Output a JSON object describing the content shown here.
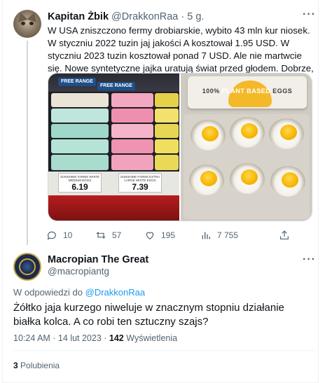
{
  "tweet": {
    "author_name": "Kapitan Żbik",
    "author_handle": "@DrakkonRaa",
    "separator": "·",
    "time": "5 g.",
    "text": "W USA zniszczono fermy drobiarskie, wybito 43 mln kur niosek. W styczniu 2022 tuzin jaj jakości A kosztował 1.95 USD. W styczniu 2023 tuzin kosztował ponad 7 USD. Ale nie martwcie się. Nowe syntetyczne jajka uratują świat przed głodem. Dobrze, że ktoś nad nami czuwa",
    "more_icon": "more-horizontal-icon",
    "media": {
      "left_image": {
        "shelf_labels": [
          "FREE RANGE",
          "FREE RANGE"
        ],
        "tag_left_caption": "SUNSHINE FARMS WHITE MEDIUM EGGS",
        "tag_left_price": "6.19",
        "tag_right_caption": "SUNSHINE FARMS EXTRA LARGE WHITE EGGS",
        "tag_right_price": "7.39"
      },
      "right_image": {
        "lid_text_left": "100%",
        "lid_text_mid": "PLANT BASED",
        "lid_text_right": "EGGS"
      }
    },
    "actions": {
      "reply_count": "10",
      "retweet_count": "57",
      "like_count": "195",
      "views_count": "7 755",
      "icons": [
        "reply-icon",
        "retweet-icon",
        "like-icon",
        "views-icon",
        "share-icon"
      ]
    }
  },
  "reply": {
    "author_name": "Macropian The Great",
    "author_handle": "@macropiantg",
    "reply_to_prefix": "W odpowiedzi do",
    "reply_to_handle": "@DrakkonRaa",
    "text": "Żółtko jaja kurzego niweluje w znacznym stopniu działanie białka kolca. A co robi ten sztuczny szajs?",
    "timestamp": "10:24 AM · 14 lut 2023 ·",
    "views_count": "142",
    "views_label": "Wyświetlenia",
    "likes_count": "3",
    "likes_label": "Polubienia",
    "more_icon": "more-horizontal-icon"
  },
  "colors": {
    "text_primary": "#0f1419",
    "text_secondary": "#536471",
    "link": "#1d9bf0",
    "border": "#cfd9de"
  }
}
